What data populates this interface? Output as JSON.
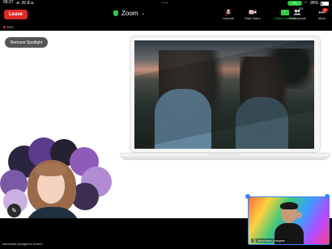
{
  "statusbar": {
    "time": "09:27",
    "date": "ศ. 26 มี.ค.",
    "battery": "95%"
  },
  "toolbar": {
    "leave_label": "Leave",
    "title": "Zoom",
    "unmute_label": "Unmute",
    "start_video_label": "Start Video",
    "share_label": "Share Content",
    "participants_label": "Participants",
    "participants_count": "122",
    "more_label": "More",
    "more_badge": "20"
  },
  "rec_label": "REC",
  "spotlight_button": "Remove Spotlight",
  "screen_share_owner": "kanchana piongam's screen",
  "self_view_name": "kanchana piongam",
  "colors": {
    "accent_green": "#2ecc40",
    "leave_red": "#e02828",
    "selection_blue": "#3b82f6"
  }
}
